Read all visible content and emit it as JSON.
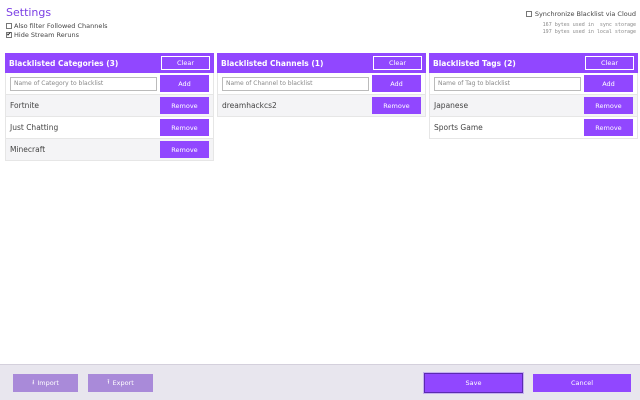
{
  "header": {
    "title": "Settings",
    "opt_followed": "Also filter Followed Channels",
    "opt_followed_checked": false,
    "opt_reruns": "Hide Stream Reruns",
    "opt_reruns_checked": true,
    "sync_label": "Synchronize Blacklist via Cloud",
    "sync_checked": false,
    "storage_sync": "167 bytes used in  sync storage",
    "storage_local": "197 bytes used in local storage"
  },
  "categories": {
    "title": "Blacklisted Categories (3)",
    "clear": "Clear",
    "placeholder": "Name of Category to blacklist",
    "add": "Add",
    "items": [
      {
        "label": "Fortnite",
        "remove": "Remove"
      },
      {
        "label": "Just Chatting",
        "remove": "Remove"
      },
      {
        "label": "Minecraft",
        "remove": "Remove"
      }
    ]
  },
  "channels": {
    "title": "Blacklisted Channels (1)",
    "clear": "Clear",
    "placeholder": "Name of Channel to blacklist",
    "add": "Add",
    "items": [
      {
        "label": "dreamhackcs2",
        "remove": "Remove"
      }
    ]
  },
  "tags": {
    "title": "Blacklisted Tags (2)",
    "clear": "Clear",
    "placeholder": "Name of Tag to blacklist",
    "add": "Add",
    "items": [
      {
        "label": "Japanese",
        "remove": "Remove"
      },
      {
        "label": "Sports Game",
        "remove": "Remove"
      }
    ]
  },
  "footer": {
    "import_icon": "import-arrow-icon",
    "import": "Import",
    "export_icon": "export-arrow-icon",
    "export": "Export",
    "save": "Save",
    "cancel": "Cancel"
  },
  "colors": {
    "accent": "#9147ff",
    "accent_light": "#a98ad9",
    "title": "#7b3fe4",
    "footer_bg": "#e8e6ee"
  }
}
